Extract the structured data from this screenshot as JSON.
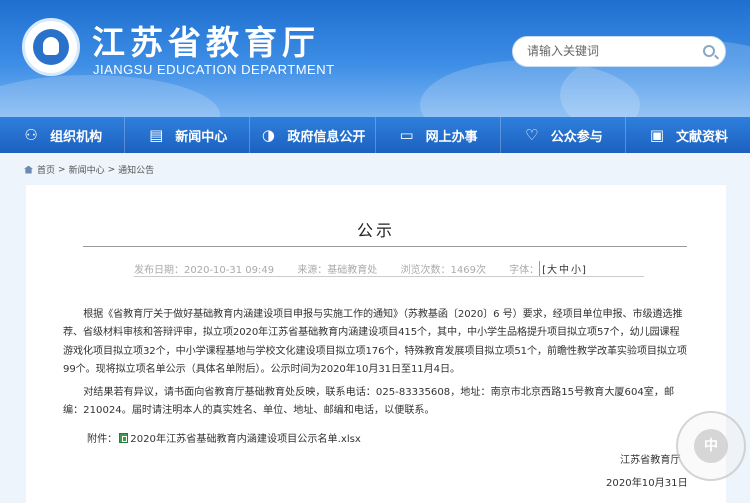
{
  "header": {
    "title": "江苏省教育厅",
    "subtitle": "JIANGSU EDUCATION DEPARTMENT",
    "search_placeholder": "请输入关键词"
  },
  "nav": {
    "items": [
      {
        "label": "组织机构",
        "icon": "org-chart-icon"
      },
      {
        "label": "新闻中心",
        "icon": "news-icon"
      },
      {
        "label": "政府信息公开",
        "icon": "info-disclosure-icon"
      },
      {
        "label": "网上办事",
        "icon": "monitor-icon"
      },
      {
        "label": "公众参与",
        "icon": "heart-icon"
      },
      {
        "label": "文献资料",
        "icon": "archive-icon"
      }
    ]
  },
  "breadcrumb": {
    "items": [
      "首页",
      "新闻中心",
      "通知公告"
    ],
    "separator": ">"
  },
  "article": {
    "title": "公示",
    "publish_time": "发布日期：2020-10-31 09:49",
    "source": "来源：基础教育处",
    "views": "浏览次数：1469次",
    "font_label": "字体：",
    "font_sizes": [
      "大",
      "中",
      "小"
    ],
    "paragraph1": "根据《省教育厅关于做好基础教育内涵建设项目申报与实施工作的通知》（苏教基函〔2020〕6 号）要求，经项目单位申报、市级遴选推荐、省级材料审核和答辩评审，拟立项2020年江苏省基础教育内涵建设项目415个，其中，中小学生品格提升项目拟立项57个，幼儿园课程游戏化项目拟立项32个，中小学课程基地与学校文化建设项目拟立项176个，特殊教育发展项目拟立项51个，前瞻性教学改革实验项目拟立项99个。现将拟立项名单公示（具体名单附后）。公示时间为2020年10月31日至11月4日。",
    "paragraph2": "对结果若有异议，请书面向省教育厅基础教育处反映，联系电话：025-83335608，地址：南京市北京西路15号教育大厦604室，邮编：210024。届时请注明本人的真实姓名、单位、地址、邮编和电话，以便联系。",
    "attachment_label": "附件：",
    "attachment_name": "2020年江苏省基础教育内涵建设项目公示名单.xlsx",
    "signer": "江苏省教育厅",
    "sign_date": "2020年10月31日"
  },
  "watermark": {
    "text": "NANTONG HIGH SCHOOL"
  }
}
